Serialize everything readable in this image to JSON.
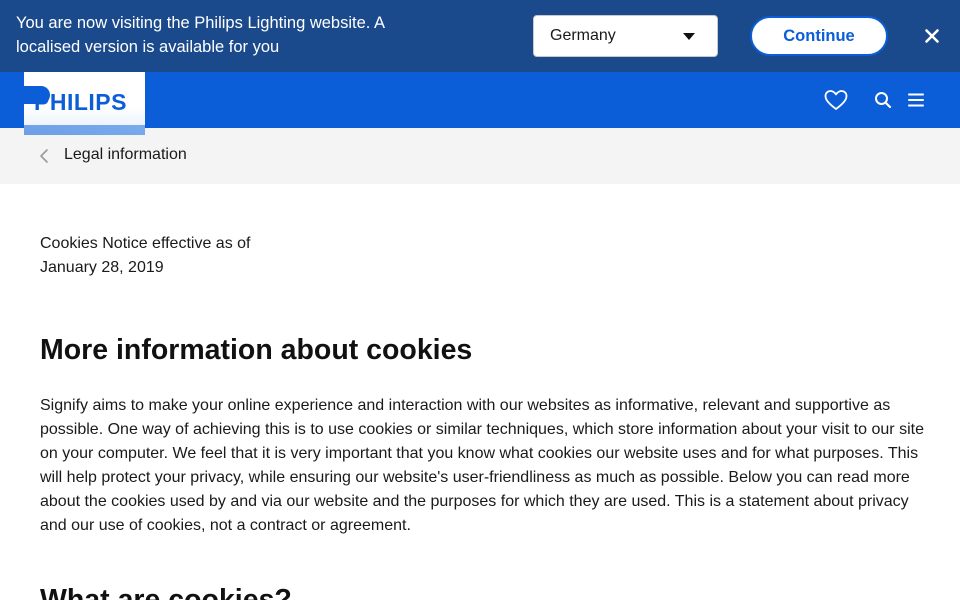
{
  "locale_banner": {
    "message": "You are now visiting the Philips Lighting website. A localised version is available for you",
    "country_selected": "Germany",
    "continue_label": "Continue"
  },
  "header": {
    "logo_text": "PHILIPS"
  },
  "breadcrumb": {
    "label": "Legal information"
  },
  "content": {
    "effective_note": "Cookies Notice effective as of January 28, 2019",
    "heading_1": "More information about cookies",
    "paragraph_1": "Signify aims to make your online experience and interaction with our websites as informative, relevant and supportive as possible. One way of achieving this is to use cookies or similar techniques, which store information about your visit to our site on your computer. We feel that it is very important that you know what cookies our website uses and for what purposes. This will help protect your privacy, while ensuring our website's user-friendliness as much as possible. Below you can read more about the cookies used by and via our website and the purposes for which they are used. This is a statement about privacy and our use of cookies, not a contract or agreement.",
    "heading_2": "What are cookies?"
  },
  "colors": {
    "banner_bg": "#1b4a8c",
    "brand_blue": "#0b5ed7",
    "breadcrumb_bg": "#f4f4f4"
  },
  "icons": {
    "close": "close-icon",
    "heart": "heart-icon",
    "search": "search-icon",
    "menu": "menu-icon",
    "chevron": "chevron-left-icon",
    "caret": "caret-down-icon"
  }
}
